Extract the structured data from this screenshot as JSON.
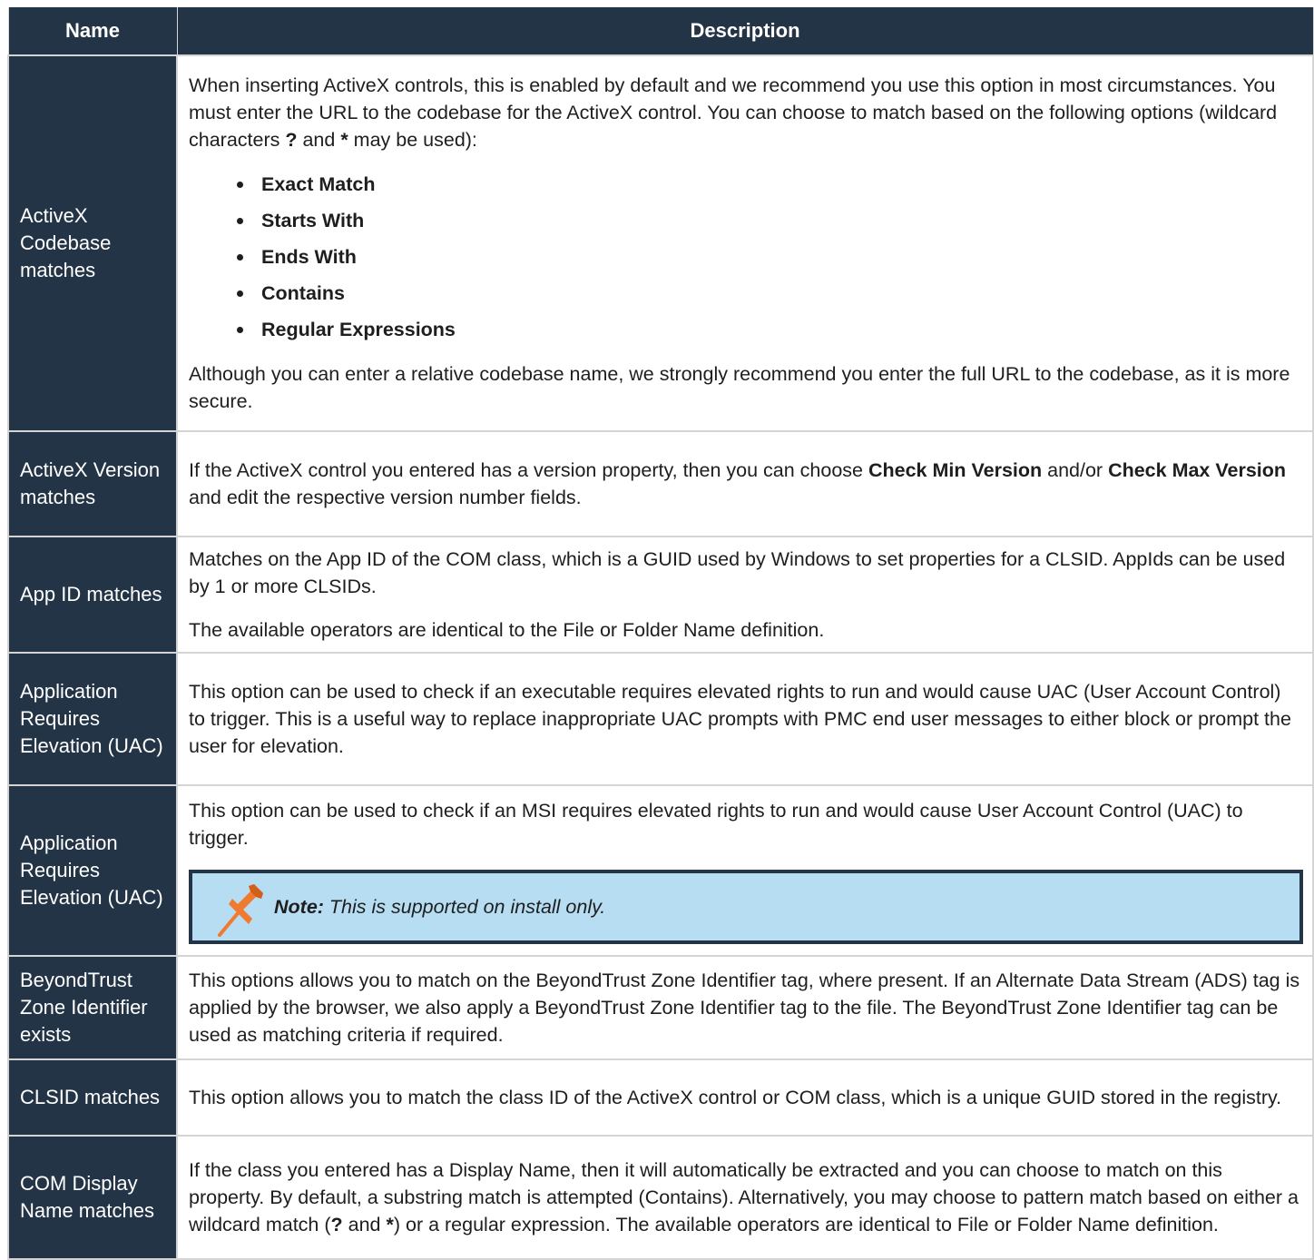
{
  "header": {
    "name": "Name",
    "description": "Description"
  },
  "rows": [
    {
      "name": "ActiveX Codebase matches",
      "p1_a": "When inserting ActiveX controls, this is enabled by default and we recommend you use this option in most circumstances. You must enter the URL to the codebase for the ActiveX control. You can choose to match based on the following options (wildcard characters ",
      "q": "?",
      "p1_and": " and ",
      "star": "*",
      "p1_b": " may be used):",
      "bullets": [
        "Exact Match",
        "Starts With",
        "Ends With",
        "Contains",
        "Regular Expressions"
      ],
      "p2": "Although you can enter a relative codebase name, we strongly recommend you enter the full URL to the codebase, as it is more secure."
    },
    {
      "name": "ActiveX Version matches",
      "a": "If the ActiveX control you entered has a version property, then you can choose ",
      "b1": "Check Min Version",
      "mid": " and/or ",
      "b2": "Check Max Version",
      "c": " and edit the respective version number fields."
    },
    {
      "name": "App ID matches",
      "p1": "Matches on the App ID of the COM class, which is a GUID used by Windows to set properties for a CLSID. AppIds can be used by 1 or more CLSIDs.",
      "p2": "The available operators are identical to the File or Folder Name definition."
    },
    {
      "name": "Application Requires Elevation (UAC)",
      "p1": "This option can be used to check if an executable requires elevated rights to run and would cause UAC (User Account Control) to trigger. This is a useful way to replace inappropriate UAC prompts with PMC end user messages to either block or prompt the user for elevation."
    },
    {
      "name": "Application Requires Elevation (UAC)",
      "p1": "This option can be used to check if an MSI requires elevated rights to run and would cause User Account Control (UAC) to trigger.",
      "note_label": "Note:",
      "note_text": " This is supported on install only.",
      "note_icon": "pushpin-icon"
    },
    {
      "name": "BeyondTrust Zone Identifier exists",
      "p1": "This options allows you to match on the BeyondTrust Zone Identifier tag, where present. If an Alternate Data Stream (ADS) tag is applied by the browser, we also apply a BeyondTrust Zone Identifier tag to the file. The BeyondTrust Zone Identifier tag can be used as matching criteria if required."
    },
    {
      "name": "CLSID matches",
      "p1": "This option allows you to match the class ID of the ActiveX control or COM class, which is a unique GUID stored in the registry."
    },
    {
      "name": "COM Display Name matches",
      "a": "If the class you entered has a Display Name, then it will automatically be extracted and you can choose to match on this property. By default, a substring match is attempted (Contains). Alternatively, you may choose to pattern match based on either a wildcard match (",
      "q": "?",
      "and": " and ",
      "star": "*",
      "b": ") or a regular expression. The available operators are identical to File or Folder Name definition."
    }
  ],
  "colors": {
    "header_bg": "#243447",
    "note_bg": "#b7ddf2",
    "pin": "#f07a2e"
  }
}
